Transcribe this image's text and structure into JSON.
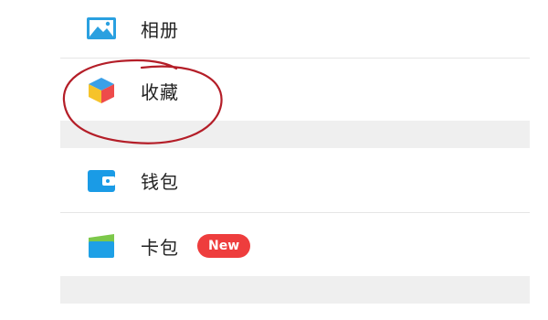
{
  "menu": {
    "items": [
      {
        "label": "相册",
        "icon": "photo-album-icon"
      },
      {
        "label": "收藏",
        "icon": "favorites-cube-icon"
      },
      {
        "label": "钱包",
        "icon": "wallet-icon"
      },
      {
        "label": "卡包",
        "icon": "card-wallet-icon",
        "badge": "New"
      }
    ]
  },
  "colors": {
    "badge": "#ee3d3d",
    "section_gap": "#efefef",
    "annotation_circle": "#b41e28",
    "photo_icon": "#2aa0e0",
    "wallet_icon": "#1a9be6"
  }
}
